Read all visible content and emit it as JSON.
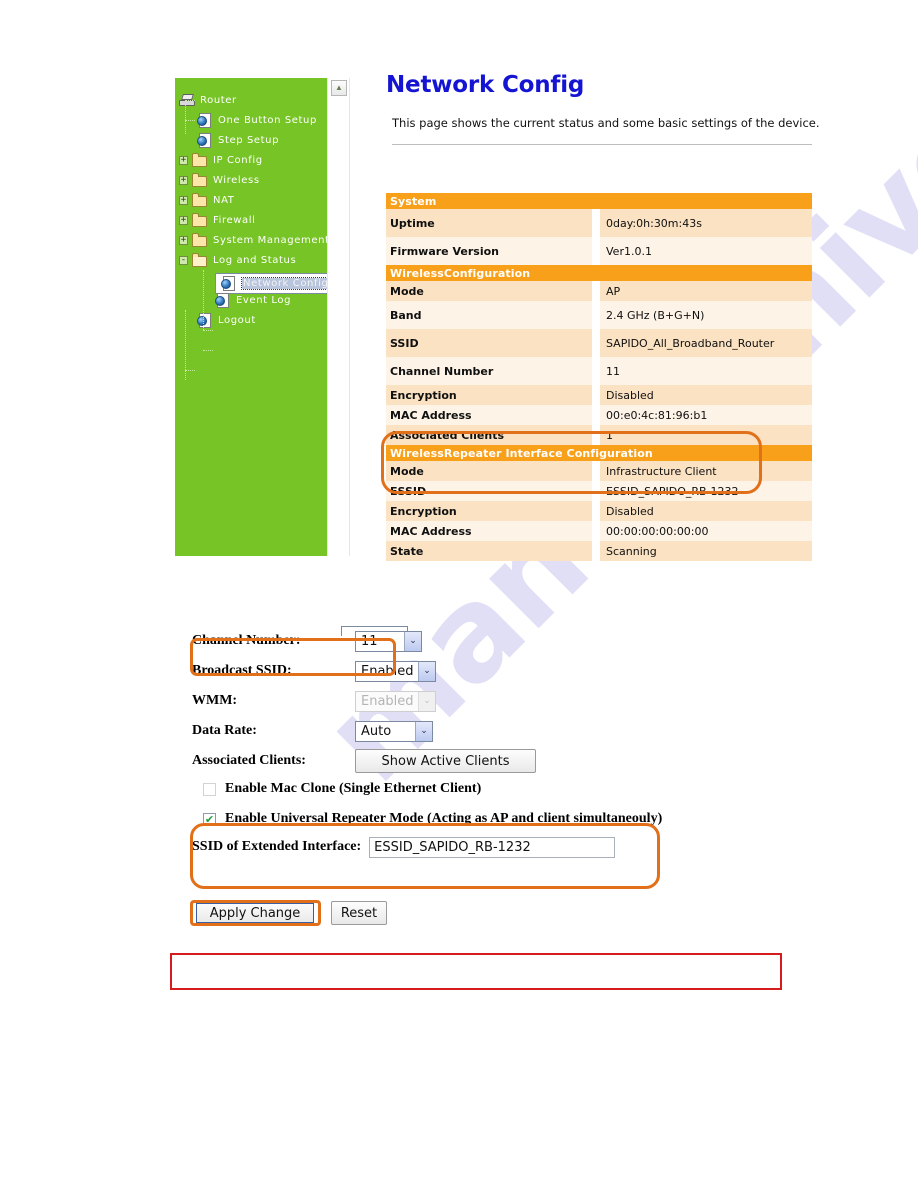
{
  "sidebar": {
    "scroll_up_glyph": "▲",
    "items": [
      {
        "label": "Router",
        "icon": "router-icon",
        "indent": 0,
        "toggle": "",
        "selected": false
      },
      {
        "label": "One Button Setup",
        "icon": "page-globe-icon",
        "indent": 1,
        "toggle": "",
        "selected": false
      },
      {
        "label": "Step Setup",
        "icon": "page-globe-icon",
        "indent": 1,
        "toggle": "",
        "selected": false
      },
      {
        "label": "IP Config",
        "icon": "folder-icon",
        "indent": 0,
        "toggle": "+",
        "selected": false
      },
      {
        "label": "Wireless",
        "icon": "folder-icon",
        "indent": 0,
        "toggle": "+",
        "selected": false
      },
      {
        "label": "NAT",
        "icon": "folder-icon",
        "indent": 0,
        "toggle": "+",
        "selected": false
      },
      {
        "label": "Firewall",
        "icon": "folder-icon",
        "indent": 0,
        "toggle": "+",
        "selected": false
      },
      {
        "label": "System Management",
        "icon": "folder-icon",
        "indent": 0,
        "toggle": "+",
        "selected": false
      },
      {
        "label": "Log and Status",
        "icon": "folder-open-icon",
        "indent": 0,
        "toggle": "-",
        "selected": false
      },
      {
        "label": "Network Config",
        "icon": "page-globe-icon",
        "indent": 2,
        "toggle": "",
        "selected": true
      },
      {
        "label": "Event Log",
        "icon": "page-globe-icon",
        "indent": 2,
        "toggle": "",
        "selected": false
      },
      {
        "label": "Logout",
        "icon": "page-globe-icon",
        "indent": 1,
        "toggle": "",
        "selected": false
      }
    ]
  },
  "header": {
    "title": "Network Config",
    "description": "This page shows the current status and some basic settings of the device."
  },
  "status_table": {
    "sections": [
      {
        "heading": "System",
        "rows": [
          {
            "key": "Uptime",
            "value": "0day:0h:30m:43s"
          },
          {
            "key": "Firmware Version",
            "value": "Ver1.0.1"
          }
        ]
      },
      {
        "heading": "WirelessConfiguration",
        "rows": [
          {
            "key": "Mode",
            "value": "AP"
          },
          {
            "key": "Band",
            "value": "2.4 GHz (B+G+N)"
          },
          {
            "key": "SSID",
            "value": "SAPIDO_All_Broadband_Router"
          },
          {
            "key": "Channel Number",
            "value": "11"
          },
          {
            "key": "Encryption",
            "value": "Disabled"
          },
          {
            "key": "MAC Address",
            "value": "00:e0:4c:81:96:b1"
          },
          {
            "key": "Associated Clients",
            "value": "1"
          }
        ]
      },
      {
        "heading": "WirelessRepeater Interface Configuration",
        "rows": [
          {
            "key": "Mode",
            "value": "Infrastructure Client"
          },
          {
            "key": "ESSID",
            "value": "ESSID_SAPIDO_RB-1232"
          },
          {
            "key": "Encryption",
            "value": "Disabled"
          },
          {
            "key": "MAC Address",
            "value": "00:00:00:00:00:00"
          },
          {
            "key": "State",
            "value": "Scanning"
          }
        ]
      }
    ]
  },
  "form": {
    "channel_number_label": "Channel Number:",
    "channel_number_value": "11",
    "broadcast_ssid_label": "Broadcast SSID:",
    "broadcast_ssid_value": "Enabled",
    "wmm_label": "WMM:",
    "wmm_value": "Enabled",
    "data_rate_label": "Data Rate:",
    "data_rate_value": "Auto",
    "associated_clients_label": "Associated Clients:",
    "show_active_clients_button": "Show Active Clients",
    "mac_clone_label": "Enable Mac Clone (Single Ethernet Client)",
    "mac_clone_checked": "",
    "universal_repeater_label": "Enable Universal Repeater Mode (Acting as AP and client simultaneouly)",
    "universal_repeater_checked": "✔",
    "ssid_extended_label": "SSID of Extended Interface:",
    "ssid_extended_value": "ESSID_SAPIDO_RB-1232",
    "apply_change_button": "Apply Change",
    "reset_button": "Reset",
    "dropdown_arrow": "⌄"
  },
  "note_box": {
    "text": ""
  },
  "watermark": {
    "text": "manualshive.com"
  },
  "colors": {
    "accent_orange": "#f9a01b",
    "highlight_ring": "#e2701a",
    "sidebar_green": "#76c425",
    "title_blue": "#1414d2",
    "note_red": "#d51b1b",
    "row_dark": "#fbe2c2",
    "row_light": "#fdf3e7"
  }
}
